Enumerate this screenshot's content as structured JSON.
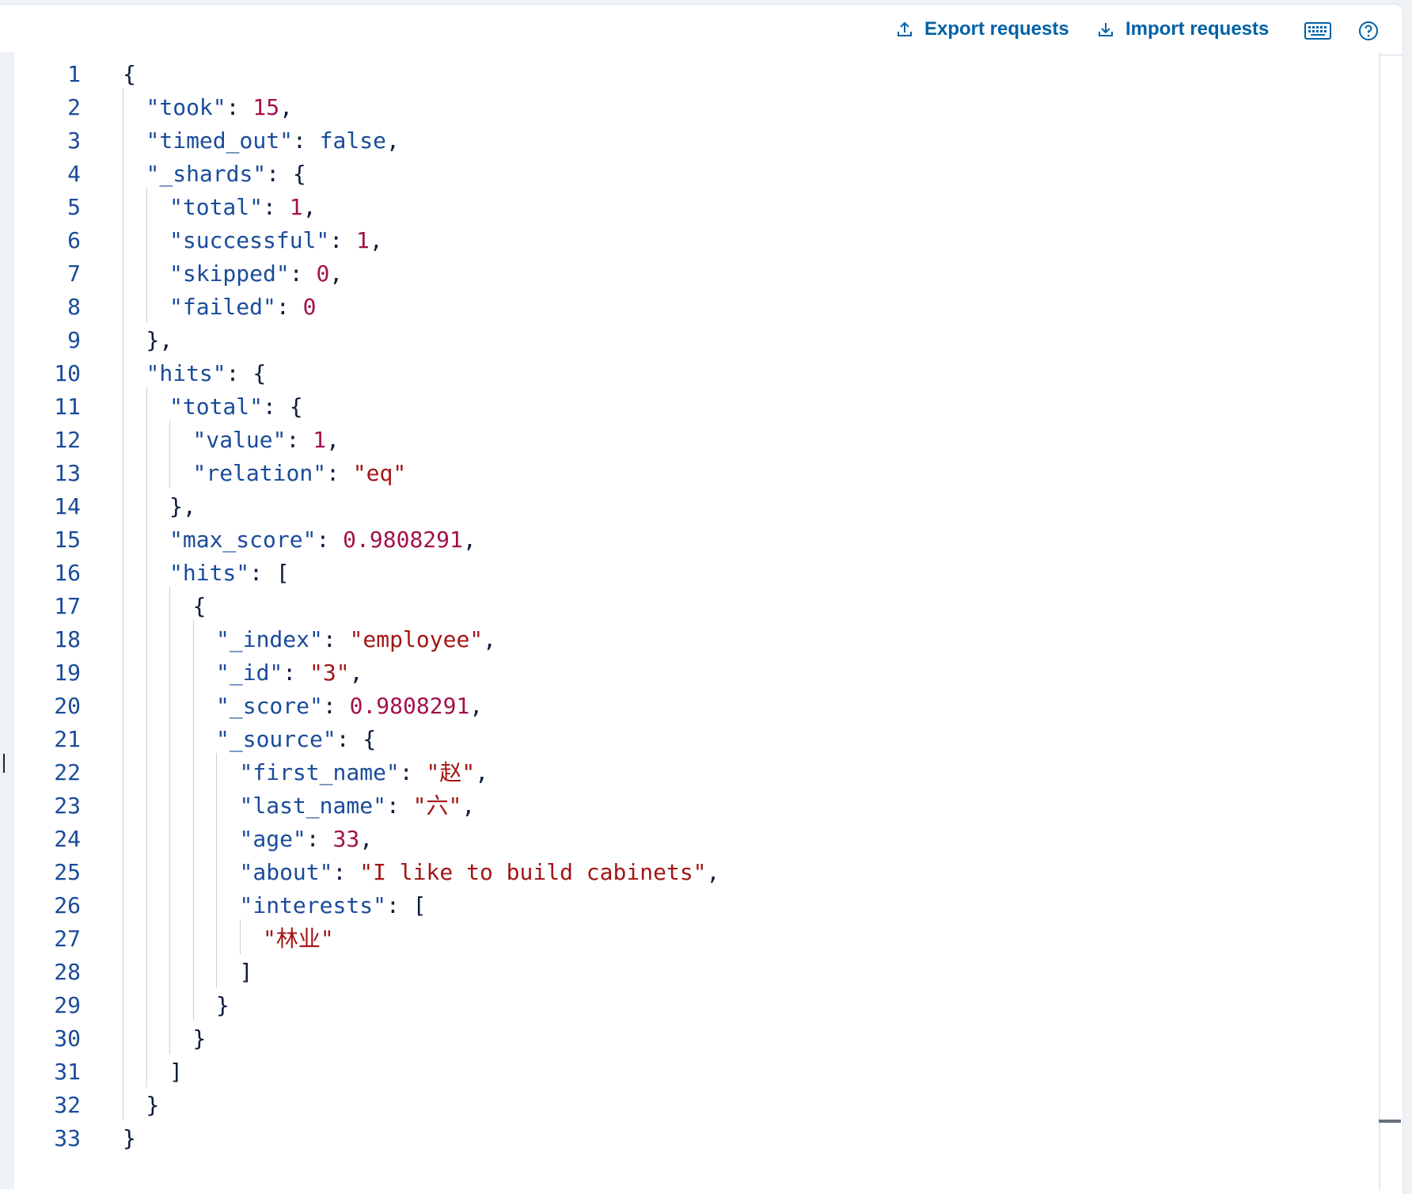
{
  "toolbar": {
    "export_label": "Export requests",
    "import_label": "Import requests",
    "keyboard_icon": "keyboard-icon",
    "help_icon": "help-icon",
    "accent_color": "#0061a6"
  },
  "editor": {
    "lines": [
      {
        "num": "1",
        "indent": 0,
        "tokens": [
          [
            "punc",
            "{"
          ]
        ]
      },
      {
        "num": "2",
        "indent": 1,
        "tokens": [
          [
            "key",
            "\"took\""
          ],
          [
            "punc",
            ": "
          ],
          [
            "num",
            "15"
          ],
          [
            "punc",
            ","
          ]
        ]
      },
      {
        "num": "3",
        "indent": 1,
        "tokens": [
          [
            "key",
            "\"timed_out\""
          ],
          [
            "punc",
            ": "
          ],
          [
            "bool",
            "false"
          ],
          [
            "punc",
            ","
          ]
        ]
      },
      {
        "num": "4",
        "indent": 1,
        "tokens": [
          [
            "key",
            "\"_shards\""
          ],
          [
            "punc",
            ": {"
          ]
        ]
      },
      {
        "num": "5",
        "indent": 2,
        "tokens": [
          [
            "key",
            "\"total\""
          ],
          [
            "punc",
            ": "
          ],
          [
            "num",
            "1"
          ],
          [
            "punc",
            ","
          ]
        ]
      },
      {
        "num": "6",
        "indent": 2,
        "tokens": [
          [
            "key",
            "\"successful\""
          ],
          [
            "punc",
            ": "
          ],
          [
            "num",
            "1"
          ],
          [
            "punc",
            ","
          ]
        ]
      },
      {
        "num": "7",
        "indent": 2,
        "tokens": [
          [
            "key",
            "\"skipped\""
          ],
          [
            "punc",
            ": "
          ],
          [
            "num",
            "0"
          ],
          [
            "punc",
            ","
          ]
        ]
      },
      {
        "num": "8",
        "indent": 2,
        "tokens": [
          [
            "key",
            "\"failed\""
          ],
          [
            "punc",
            ": "
          ],
          [
            "num",
            "0"
          ]
        ]
      },
      {
        "num": "9",
        "indent": 1,
        "tokens": [
          [
            "punc",
            "},"
          ]
        ]
      },
      {
        "num": "10",
        "indent": 1,
        "tokens": [
          [
            "key",
            "\"hits\""
          ],
          [
            "punc",
            ": {"
          ]
        ]
      },
      {
        "num": "11",
        "indent": 2,
        "tokens": [
          [
            "key",
            "\"total\""
          ],
          [
            "punc",
            ": {"
          ]
        ]
      },
      {
        "num": "12",
        "indent": 3,
        "tokens": [
          [
            "key",
            "\"value\""
          ],
          [
            "punc",
            ": "
          ],
          [
            "num",
            "1"
          ],
          [
            "punc",
            ","
          ]
        ]
      },
      {
        "num": "13",
        "indent": 3,
        "tokens": [
          [
            "key",
            "\"relation\""
          ],
          [
            "punc",
            ": "
          ],
          [
            "str",
            "\"eq\""
          ]
        ]
      },
      {
        "num": "14",
        "indent": 2,
        "tokens": [
          [
            "punc",
            "},"
          ]
        ]
      },
      {
        "num": "15",
        "indent": 2,
        "tokens": [
          [
            "key",
            "\"max_score\""
          ],
          [
            "punc",
            ": "
          ],
          [
            "num",
            "0.9808291"
          ],
          [
            "punc",
            ","
          ]
        ]
      },
      {
        "num": "16",
        "indent": 2,
        "tokens": [
          [
            "key",
            "\"hits\""
          ],
          [
            "punc",
            ": ["
          ]
        ]
      },
      {
        "num": "17",
        "indent": 3,
        "tokens": [
          [
            "punc",
            "{"
          ]
        ]
      },
      {
        "num": "18",
        "indent": 4,
        "tokens": [
          [
            "key",
            "\"_index\""
          ],
          [
            "punc",
            ": "
          ],
          [
            "str",
            "\"employee\""
          ],
          [
            "punc",
            ","
          ]
        ]
      },
      {
        "num": "19",
        "indent": 4,
        "tokens": [
          [
            "key",
            "\"_id\""
          ],
          [
            "punc",
            ": "
          ],
          [
            "str",
            "\"3\""
          ],
          [
            "punc",
            ","
          ]
        ]
      },
      {
        "num": "20",
        "indent": 4,
        "tokens": [
          [
            "key",
            "\"_score\""
          ],
          [
            "punc",
            ": "
          ],
          [
            "num",
            "0.9808291"
          ],
          [
            "punc",
            ","
          ]
        ]
      },
      {
        "num": "21",
        "indent": 4,
        "tokens": [
          [
            "key",
            "\"_source\""
          ],
          [
            "punc",
            ": {"
          ]
        ]
      },
      {
        "num": "22",
        "indent": 5,
        "tokens": [
          [
            "key",
            "\"first_name\""
          ],
          [
            "punc",
            ": "
          ],
          [
            "str",
            "\"赵\""
          ],
          [
            "punc",
            ","
          ]
        ]
      },
      {
        "num": "23",
        "indent": 5,
        "tokens": [
          [
            "key",
            "\"last_name\""
          ],
          [
            "punc",
            ": "
          ],
          [
            "str",
            "\"六\""
          ],
          [
            "punc",
            ","
          ]
        ]
      },
      {
        "num": "24",
        "indent": 5,
        "tokens": [
          [
            "key",
            "\"age\""
          ],
          [
            "punc",
            ": "
          ],
          [
            "num",
            "33"
          ],
          [
            "punc",
            ","
          ]
        ]
      },
      {
        "num": "25",
        "indent": 5,
        "tokens": [
          [
            "key",
            "\"about\""
          ],
          [
            "punc",
            ": "
          ],
          [
            "str",
            "\"I like to build cabinets\""
          ],
          [
            "punc",
            ","
          ]
        ]
      },
      {
        "num": "26",
        "indent": 5,
        "tokens": [
          [
            "key",
            "\"interests\""
          ],
          [
            "punc",
            ": ["
          ]
        ]
      },
      {
        "num": "27",
        "indent": 6,
        "tokens": [
          [
            "str",
            "\"林业\""
          ]
        ]
      },
      {
        "num": "28",
        "indent": 5,
        "tokens": [
          [
            "punc",
            "]"
          ]
        ]
      },
      {
        "num": "29",
        "indent": 4,
        "tokens": [
          [
            "punc",
            "}"
          ]
        ]
      },
      {
        "num": "30",
        "indent": 3,
        "tokens": [
          [
            "punc",
            "}"
          ]
        ]
      },
      {
        "num": "31",
        "indent": 2,
        "tokens": [
          [
            "punc",
            "]"
          ]
        ]
      },
      {
        "num": "32",
        "indent": 1,
        "tokens": [
          [
            "punc",
            "}"
          ]
        ]
      },
      {
        "num": "33",
        "indent": 0,
        "tokens": [
          [
            "punc",
            "}"
          ]
        ]
      }
    ]
  }
}
